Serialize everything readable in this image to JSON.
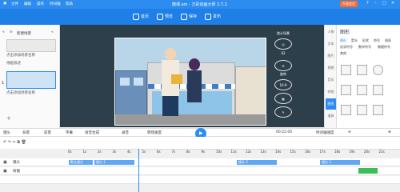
{
  "window": {
    "title": "微课.am - 万彩动画大师 2.7.2",
    "menus": [
      "文件",
      "编辑",
      "操作",
      "时间轴",
      "帮助"
    ],
    "upgrade_label": "升级会员"
  },
  "toolbar": [
    {
      "label": "首页"
    },
    {
      "label": "预览"
    },
    {
      "label": "保存"
    },
    {
      "label": "发布"
    }
  ],
  "left_panel": {
    "new_scene_label": "新建场景",
    "scene_items": [
      {
        "label": "点击添加场景名称"
      },
      {
        "label": "线框叙述"
      },
      {
        "label": "点击添加场景名称"
      }
    ],
    "scene_number": "1"
  },
  "canvas": {
    "tools": [
      {
        "label": "统计场景"
      },
      {
        "label": "62"
      },
      {
        "label": "旋转"
      },
      {
        "label": "16:9"
      }
    ]
  },
  "right_panel": {
    "header": "图形",
    "tabs_row1": [
      "图形",
      "箭头",
      "形状",
      "符号",
      "线条"
    ],
    "tabs_row2": [
      "化学符号",
      "数学符号",
      "物理符号"
    ],
    "tabs_row3": [
      "其他"
    ],
    "side_tabs": [
      "人物",
      "文本",
      "图片",
      "视频",
      "音乐",
      "特效",
      "图形",
      "道具"
    ]
  },
  "playbar": {
    "items": [
      "镜头",
      "背景",
      "前景",
      "字幕",
      "语音合成",
      "录音",
      "转场速度",
      "00:22.00"
    ],
    "time_display": "00:22.00",
    "speed_label": "时间轴速度"
  },
  "ruler": {
    "ticks": [
      "0s",
      "1s",
      "2s",
      "3s",
      "4s",
      "5s",
      "6s",
      "7s",
      "8s",
      "9s",
      "10s",
      "11s",
      "12s",
      "13s",
      "14s",
      "15s",
      "16s",
      "17s",
      "18s",
      "19s",
      "20s",
      "21s"
    ]
  },
  "tracks": [
    {
      "name": "镜头",
      "clips": [
        {
          "label": "默认镜头"
        },
        {
          "label": "镜头 1"
        },
        {
          "label": "镜头 2"
        },
        {
          "label": "镜头 3"
        }
      ]
    },
    {
      "name": "商铺",
      "clips": []
    },
    {
      "name": "",
      "clips": []
    }
  ],
  "colors": {
    "accent": "#2d8cf0",
    "canvas_bg": "#2e3f4c",
    "clip": "#5fa8f5",
    "upgrade": "#ff6b2c"
  }
}
